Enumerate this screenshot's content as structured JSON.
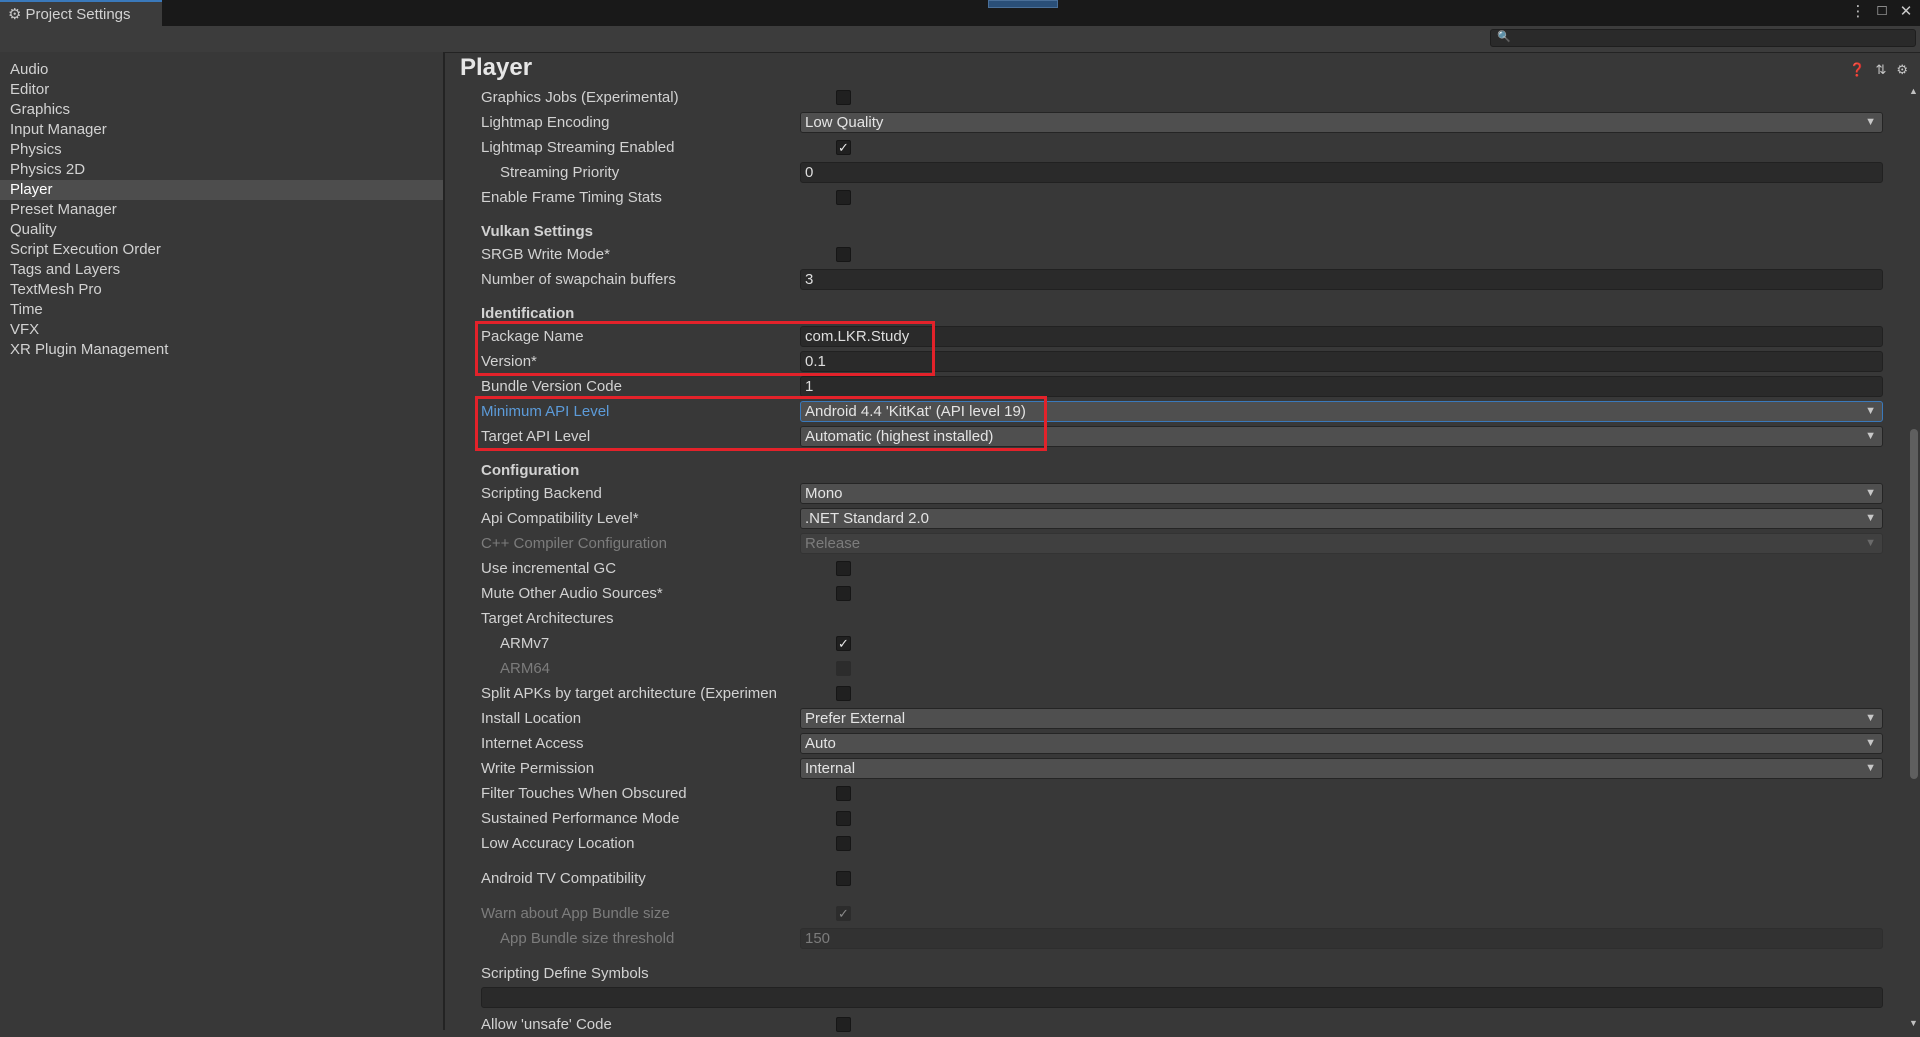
{
  "window": {
    "tab_title": "Project Settings",
    "tab_icon": "gear-icon",
    "controls": [
      "more-icon",
      "maximize-icon",
      "close-icon"
    ]
  },
  "search": {
    "placeholder": ""
  },
  "sidebar": {
    "items": [
      {
        "label": "Audio"
      },
      {
        "label": "Editor"
      },
      {
        "label": "Graphics"
      },
      {
        "label": "Input Manager"
      },
      {
        "label": "Physics"
      },
      {
        "label": "Physics 2D"
      },
      {
        "label": "Player",
        "selected": true
      },
      {
        "label": "Preset Manager"
      },
      {
        "label": "Quality"
      },
      {
        "label": "Script Execution Order"
      },
      {
        "label": "Tags and Layers"
      },
      {
        "label": "TextMesh Pro"
      },
      {
        "label": "Time"
      },
      {
        "label": "VFX"
      },
      {
        "label": "XR Plugin Management"
      }
    ]
  },
  "main": {
    "title": "Player",
    "header_icons": [
      "help-icon",
      "preset-icon",
      "settings-icon"
    ],
    "rows": {
      "graphics_jobs": {
        "label": "Graphics Jobs (Experimental)",
        "checked": false
      },
      "lightmap_encoding": {
        "label": "Lightmap Encoding",
        "value": "Low Quality"
      },
      "lightmap_streaming": {
        "label": "Lightmap Streaming Enabled",
        "checked": true
      },
      "streaming_priority": {
        "label": "Streaming Priority",
        "value": "0"
      },
      "frame_timing": {
        "label": "Enable Frame Timing Stats",
        "checked": false
      },
      "vulkan_header": "Vulkan Settings",
      "srgb_write": {
        "label": "SRGB Write Mode*",
        "checked": false
      },
      "swapchain": {
        "label": "Number of swapchain buffers",
        "value": "3"
      },
      "identification_header": "Identification",
      "package_name": {
        "label": "Package Name",
        "value": "com.LKR.Study"
      },
      "version": {
        "label": "Version*",
        "value": "0.1"
      },
      "bundle_code": {
        "label": "Bundle Version Code",
        "value": "1"
      },
      "min_api": {
        "label": "Minimum API Level",
        "value": "Android 4.4 'KitKat' (API level 19)"
      },
      "target_api": {
        "label": "Target API Level",
        "value": "Automatic (highest installed)"
      },
      "configuration_header": "Configuration",
      "scripting_backend": {
        "label": "Scripting Backend",
        "value": "Mono"
      },
      "api_compat": {
        "label": "Api Compatibility Level*",
        "value": ".NET Standard 2.0"
      },
      "cpp_compiler": {
        "label": "C++ Compiler Configuration",
        "value": "Release"
      },
      "incremental_gc": {
        "label": "Use incremental GC",
        "checked": false
      },
      "mute_audio": {
        "label": "Mute Other Audio Sources*",
        "checked": false
      },
      "target_arch": {
        "label": "Target Architectures"
      },
      "armv7": {
        "label": "ARMv7",
        "checked": true
      },
      "arm64": {
        "label": "ARM64",
        "checked": false
      },
      "split_apks": {
        "label": "Split APKs by target architecture (Experimen",
        "checked": false
      },
      "install_location": {
        "label": "Install Location",
        "value": "Prefer External"
      },
      "internet_access": {
        "label": "Internet Access",
        "value": "Auto"
      },
      "write_permission": {
        "label": "Write Permission",
        "value": "Internal"
      },
      "filter_touches": {
        "label": "Filter Touches When Obscured",
        "checked": false
      },
      "sustained_perf": {
        "label": "Sustained Performance Mode",
        "checked": false
      },
      "low_accuracy": {
        "label": "Low Accuracy Location",
        "checked": false
      },
      "android_tv": {
        "label": "Android TV Compatibility",
        "checked": false
      },
      "warn_bundle": {
        "label": "Warn about App Bundle size",
        "checked": true
      },
      "bundle_threshold": {
        "label": "App Bundle size threshold",
        "value": "150"
      },
      "define_symbols": {
        "label": "Scripting Define Symbols",
        "value": ""
      },
      "allow_unsafe": {
        "label": "Allow 'unsafe' Code",
        "checked": false
      }
    }
  },
  "colors": {
    "accent": "#3a79bb",
    "highlight_box": "#e3222a",
    "link_label": "#5c9bd9",
    "background": "#383838"
  }
}
